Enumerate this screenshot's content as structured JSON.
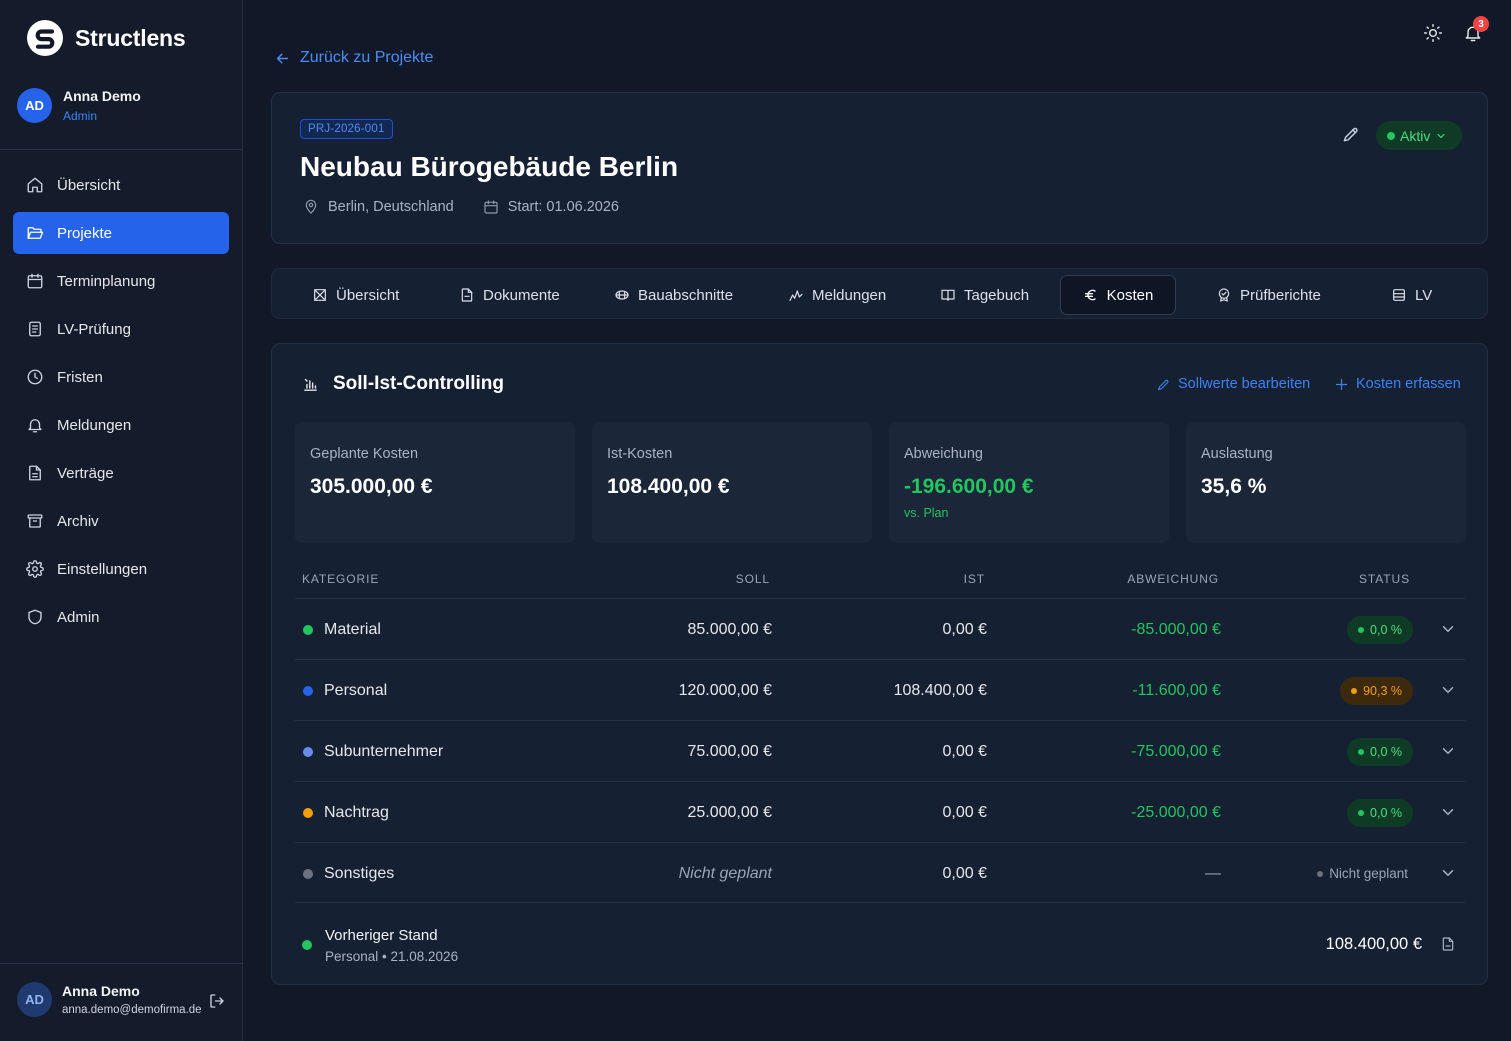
{
  "app": {
    "name": "Structlens"
  },
  "user": {
    "name": "Anna Demo",
    "initials": "AD",
    "role": "Admin",
    "email": "anna.demo@demofirma.de"
  },
  "sidebar": {
    "items": [
      {
        "label": "Übersicht",
        "icon": "home-icon"
      },
      {
        "label": "Projekte",
        "icon": "folder-open-icon",
        "active": true
      },
      {
        "label": "Terminplanung",
        "icon": "calendar-icon"
      },
      {
        "label": "LV-Prüfung",
        "icon": "clipboard-check-icon"
      },
      {
        "label": "Fristen",
        "icon": "clock-icon"
      },
      {
        "label": "Meldungen",
        "icon": "bell-icon"
      },
      {
        "label": "Verträge",
        "icon": "file-text-icon"
      },
      {
        "label": "Archiv",
        "icon": "archive-icon"
      },
      {
        "label": "Einstellungen",
        "icon": "gear-icon"
      },
      {
        "label": "Admin",
        "icon": "shield-icon"
      }
    ]
  },
  "topbar": {
    "notifications_count": "3"
  },
  "back_link": "Zurück zu Projekte",
  "project": {
    "code": "PRJ-2026-001",
    "title": "Neubau Bürogebäude Berlin",
    "location": "Berlin, Deutschland",
    "start": "Start: 01.06.2026",
    "status": "Aktiv"
  },
  "tabs": [
    {
      "label": "Übersicht",
      "icon": "layout-icon"
    },
    {
      "label": "Dokumente",
      "icon": "document-icon"
    },
    {
      "label": "Bauabschnitte",
      "icon": "layers-icon"
    },
    {
      "label": "Meldungen",
      "icon": "activity-icon"
    },
    {
      "label": "Tagebuch",
      "icon": "book-icon"
    },
    {
      "label": "Kosten",
      "icon": "euro-icon",
      "active": true
    },
    {
      "label": "Prüfberichte",
      "icon": "badge-check-icon"
    },
    {
      "label": "LV",
      "icon": "list-icon"
    }
  ],
  "controlling": {
    "title": "Soll-Ist-Controlling",
    "edit_targets": "Sollwerte bearbeiten",
    "add_costs": "Kosten erfassen",
    "stats": [
      {
        "label": "Geplante Kosten",
        "value": "305.000,00 €"
      },
      {
        "label": "Ist-Kosten",
        "value": "108.400,00 €"
      },
      {
        "label": "Abweichung",
        "value": "-196.600,00 €",
        "sub": "vs. Plan"
      },
      {
        "label": "Auslastung",
        "value": "35,6 %"
      }
    ],
    "columns": [
      "KATEGORIE",
      "SOLL",
      "IST",
      "ABWEICHUNG",
      "STATUS"
    ],
    "rows": [
      {
        "category": "Material",
        "color": "#22c55e",
        "soll": "85.000,00 €",
        "ist": "0,00 €",
        "deviation": "-85.000,00 €",
        "status": "0,0 %",
        "status_type": "green"
      },
      {
        "category": "Personal",
        "color": "#2563eb",
        "soll": "120.000,00 €",
        "ist": "108.400,00 €",
        "deviation": "-11.600,00 €",
        "status": "90,3 %",
        "status_type": "amber"
      },
      {
        "category": "Subunternehmer",
        "color": "#6690e8",
        "soll": "75.000,00 €",
        "ist": "0,00 €",
        "deviation": "-75.000,00 €",
        "status": "0,0 %",
        "status_type": "green"
      },
      {
        "category": "Nachtrag",
        "color": "#f59e0b",
        "soll": "25.000,00 €",
        "ist": "0,00 €",
        "deviation": "-25.000,00 €",
        "status": "0,0 %",
        "status_type": "green"
      },
      {
        "category": "Sonstiges",
        "color": "#6b7280",
        "soll": "Nicht geplant",
        "ist": "0,00 €",
        "deviation": "—",
        "status": "Nicht geplant",
        "status_type": "plain"
      }
    ],
    "previous": {
      "title": "Vorheriger Stand",
      "subtitle": "Personal • 21.08.2026",
      "amount": "108.400,00 €"
    }
  }
}
